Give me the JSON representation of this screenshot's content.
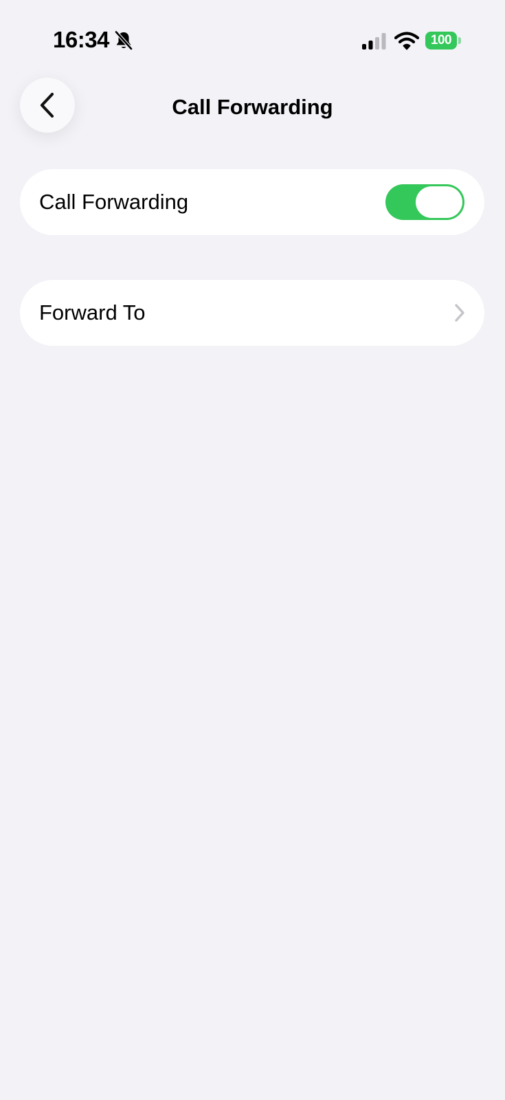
{
  "status_bar": {
    "time": "16:34",
    "battery_level": "100",
    "silent_icon": "bell-slash-icon",
    "signal_icon": "cellular-signal-icon",
    "wifi_icon": "wifi-icon",
    "battery_color": "#34c759"
  },
  "nav": {
    "title": "Call Forwarding",
    "back_icon": "chevron-left-icon"
  },
  "settings": {
    "call_forwarding": {
      "label": "Call Forwarding",
      "enabled": true,
      "toggle_color": "#34c759"
    },
    "forward_to": {
      "label": "Forward To",
      "icon": "chevron-right-icon"
    }
  }
}
